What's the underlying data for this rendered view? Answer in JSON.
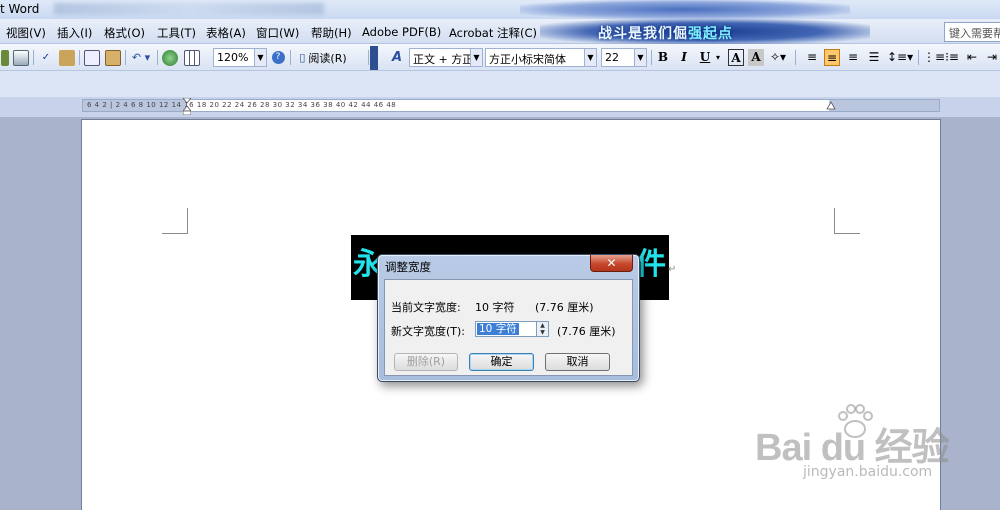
{
  "window": {
    "title_fragment": "t Word",
    "banner_text_a": "战斗是我们倔",
    "banner_text_b": "强起点"
  },
  "menu": {
    "items": [
      "视图(V)",
      "插入(I)",
      "格式(O)",
      "工具(T)",
      "表格(A)",
      "窗口(W)",
      "帮助(H)",
      "Adobe PDF(B)",
      "Acrobat 注释(C)"
    ],
    "help_placeholder": "键入需要帮"
  },
  "toolbar": {
    "zoom": "120%",
    "read_label": "阅读(R)",
    "style": "正文 + 方正",
    "font": "方正小标宋简体",
    "font_size": "22",
    "bold": "B",
    "italic": "I",
    "underline": "U",
    "char_border": "A",
    "char_shade": "A"
  },
  "ruler": {
    "numbers": "6  4  2  |  2  4  6  8  10  12  14  16  18  20  22  24  26  28  30  32  34  36  38  40  42  44  46  48"
  },
  "document": {
    "first_char": "永",
    "last_char": "件"
  },
  "dialog": {
    "title": "调整宽度",
    "current_label": "当前文字宽度:",
    "current_value": "10 字符",
    "current_cm": "(7.76 厘米)",
    "new_label": "新文字宽度(T):",
    "new_value": "10 字符",
    "new_cm": "(7.76 厘米)",
    "delete_button": "删除(R)",
    "ok_button": "确定",
    "cancel_button": "取消"
  },
  "watermark": {
    "logo": "Bai du 经验",
    "site": "jingyan.baidu.com"
  }
}
